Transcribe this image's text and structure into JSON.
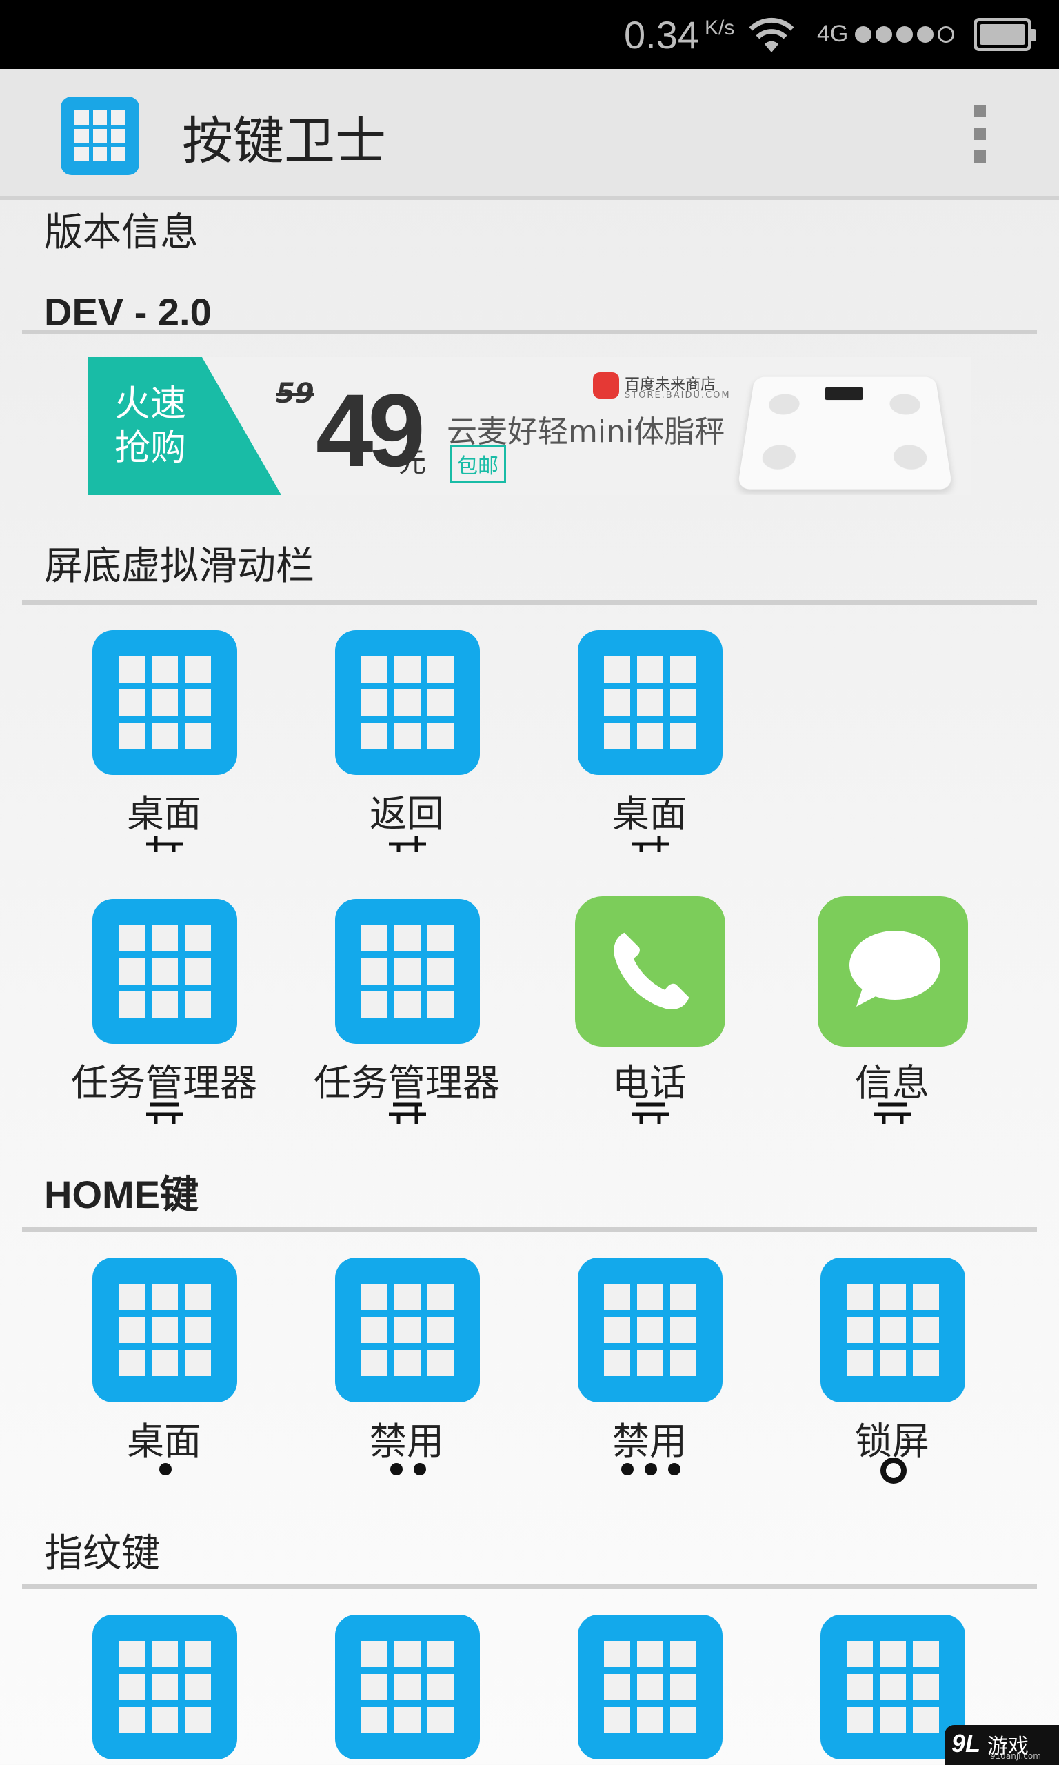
{
  "status_bar": {
    "speed": "0.34",
    "speed_unit": "K/s",
    "network": "4G",
    "signal_level": 4,
    "signal_max": 5
  },
  "app_bar": {
    "title": "按键卫士",
    "logo_icon": "app-grid-icon",
    "menu_icon": "overflow-menu-icon"
  },
  "version": {
    "heading": "版本信息",
    "value": "DEV - 2.0"
  },
  "ad_banner": {
    "left_text": "火速抢购",
    "old_price": "59",
    "price": "49",
    "currency": "元",
    "store_name": "百度未来商店",
    "store_sub": "STORE.BAIDU.COM",
    "product": "云麦好轻mini体脂秤",
    "tag": "包邮",
    "accent_color": "#19bca6"
  },
  "sections": {
    "nav_bar": {
      "title": "屏底虚拟滑动栏",
      "row1": [
        {
          "label": "桌面",
          "icon": "app-grid-icon"
        },
        {
          "label": "返回",
          "icon": "app-grid-icon"
        },
        {
          "label": "桌面",
          "icon": "app-grid-icon"
        }
      ],
      "row2": [
        {
          "label": "任务管理器",
          "icon": "app-grid-icon"
        },
        {
          "label": "任务管理器",
          "icon": "app-grid-icon"
        },
        {
          "label": "电话",
          "icon": "phone-icon"
        },
        {
          "label": "信息",
          "icon": "message-icon"
        }
      ]
    },
    "home_key": {
      "title": "HOME键",
      "items": [
        {
          "label": "桌面",
          "gesture": "single-tap"
        },
        {
          "label": "禁用",
          "gesture": "double-tap"
        },
        {
          "label": "禁用",
          "gesture": "triple-tap"
        },
        {
          "label": "锁屏",
          "gesture": "long-press"
        }
      ]
    },
    "fingerprint_key": {
      "title": "指纹键"
    }
  },
  "colors": {
    "tile_blue": "#13a9eb",
    "tile_green": "#7ccd5a"
  },
  "watermark": {
    "mark": "9L",
    "text": "游戏",
    "sub": "91danji.com"
  }
}
